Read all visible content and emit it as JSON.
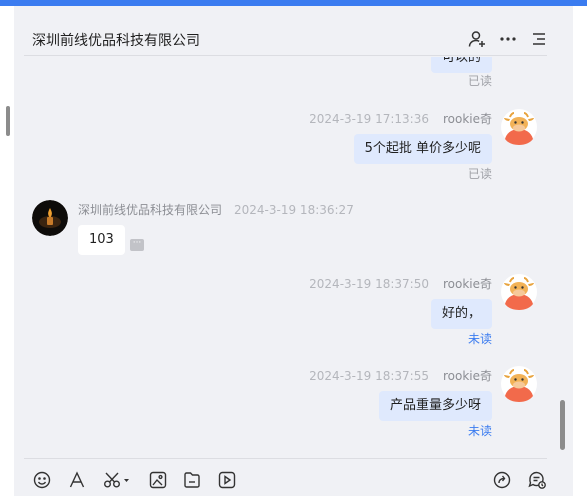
{
  "header": {
    "title": "深圳前线优品科技有限公司",
    "icons": [
      "add-member-icon",
      "more-icon",
      "list-menu-icon"
    ]
  },
  "messages": [
    {
      "side": "me",
      "text": "可以的",
      "status": "已读"
    },
    {
      "side": "me",
      "time": "2024-3-19 17:13:36",
      "sender": "rookie奇",
      "text": "5个起批 单价多少呢",
      "status": "已读"
    },
    {
      "side": "other",
      "sender": "深圳前线优品科技有限公司",
      "time": "2024-3-19 18:36:27",
      "text": "103",
      "more": "···"
    },
    {
      "side": "me",
      "time": "2024-3-19 18:37:50",
      "sender": "rookie奇",
      "text": "好的，",
      "status": "未读"
    },
    {
      "side": "me",
      "time": "2024-3-19 18:37:55",
      "sender": "rookie奇",
      "text": "产品重量多少呀",
      "status": "未读"
    }
  ],
  "toolbar": {
    "left_icons": [
      "emoji-icon",
      "font-icon",
      "screenshot-scissors-icon",
      "image-icon",
      "file-icon",
      "video-icon"
    ],
    "right_icons": [
      "share-icon",
      "chat-history-icon"
    ]
  },
  "colors": {
    "accent": "#3b7cf0",
    "my_bubble": "#dfe9fd",
    "background": "#f0f1f5",
    "unread": "#3b7cf0"
  }
}
